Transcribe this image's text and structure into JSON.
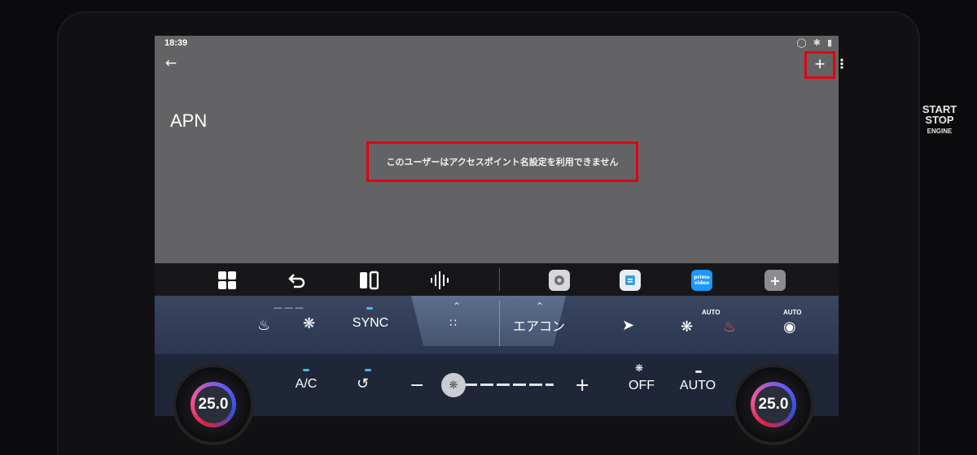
{
  "status_bar": {
    "time": "18:39"
  },
  "app_bar": {
    "back_icon": "arrow-left-icon",
    "add_label": "+",
    "overflow_icon": "more-vert-icon"
  },
  "page": {
    "title": "APN",
    "message": "このユーザーはアクセスポイント名設定を利用できません"
  },
  "highlight_color": "#e3000f",
  "dock": {
    "items": [
      {
        "icon": "app-grid-icon"
      },
      {
        "icon": "undo-icon"
      },
      {
        "icon": "split-screen-icon"
      },
      {
        "icon": "voice-wave-icon"
      },
      {
        "icon": "settings-app-icon"
      },
      {
        "icon": "notes-app-icon"
      },
      {
        "icon": "prime-video-app-icon",
        "label": "prime video"
      },
      {
        "icon": "add-app-icon",
        "label": "+"
      }
    ]
  },
  "climate": {
    "sync_label": "SYNC",
    "aircon_label": "エアコン",
    "seat_auto_label": "AUTO",
    "steering_auto_label": "AUTO",
    "ac_label": "A/C",
    "fan_off_label": "OFF",
    "auto_label": "AUTO",
    "minus_label": "−",
    "plus_label": "+",
    "left_temp": "25.0",
    "right_temp": "25.0",
    "fan_level": 0
  },
  "vehicle": {
    "start_label": "START",
    "stop_label": "STOP",
    "engine_label": "ENGINE"
  }
}
